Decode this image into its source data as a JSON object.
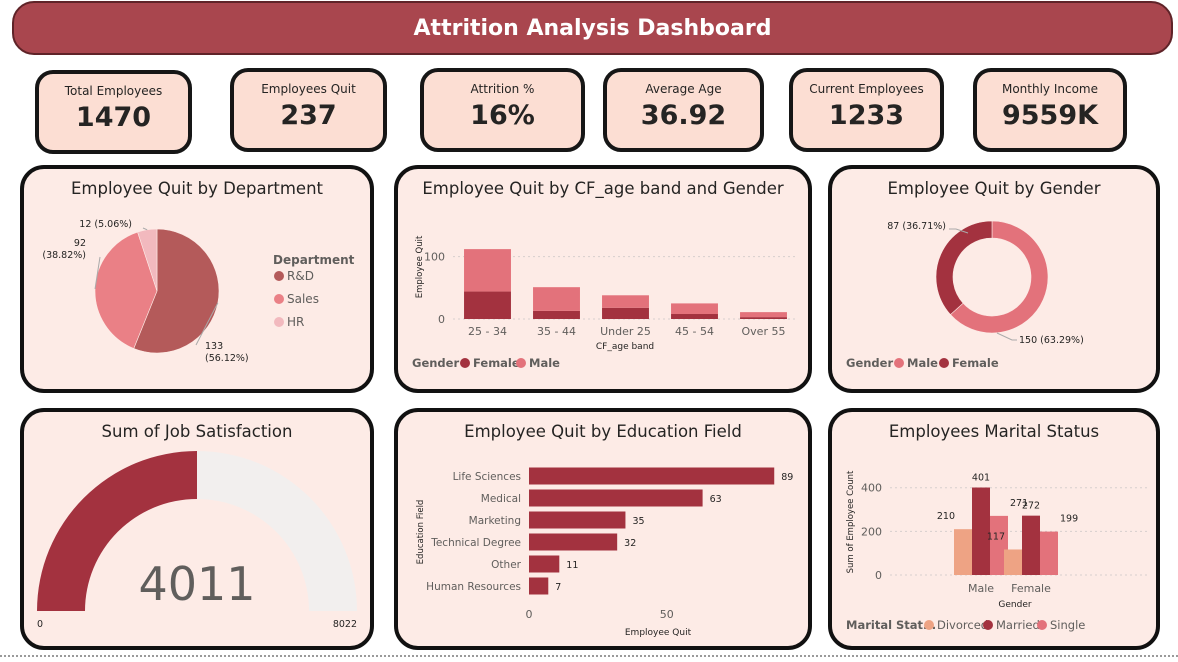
{
  "header": {
    "title": "Attrition Analysis Dashboard"
  },
  "kpis": [
    {
      "label": "Total Employees",
      "value": "1470"
    },
    {
      "label": "Employees Quit",
      "value": "237"
    },
    {
      "label": "Attrition %",
      "value": "16%"
    },
    {
      "label": "Average Age",
      "value": "36.92"
    },
    {
      "label": "Current Employees",
      "value": "1233"
    },
    {
      "label": "Monthly Income",
      "value": "9559K"
    }
  ],
  "colors": {
    "accent_dark": "#a3323f",
    "accent_mid": "#b45a5a",
    "male_pink": "#e3727b",
    "sales_pink": "#ea8086",
    "hr_pink": "#f2b9be",
    "divorced": "#eea384",
    "panel_bg": "#fdebe6",
    "kpi_bg": "#fcded3",
    "gauge_track": "#f2efee"
  },
  "chart_data": [
    {
      "type": "pie",
      "title": "Employee Quit by Department",
      "legend_title": "Department",
      "legend_position": "right",
      "slices": [
        {
          "label": "R&D",
          "value": 133,
          "text": "133 (56.12%)"
        },
        {
          "label": "Sales",
          "value": 92,
          "text": "92 (38.82%)"
        },
        {
          "label": "HR",
          "value": 12,
          "text": "12 (5.06%)"
        }
      ]
    },
    {
      "type": "bar",
      "stacked": true,
      "title": "Employee Quit by CF_age band and Gender",
      "xlabel": "CF_age band",
      "ylabel": "Employee Quit",
      "ylim": [
        0,
        125
      ],
      "yticks": [
        0,
        100
      ],
      "categories": [
        "25 - 34",
        "35 - 44",
        "Under 25",
        "45 - 54",
        "Over 55"
      ],
      "series": [
        {
          "name": "Female",
          "values": [
            44,
            13,
            18,
            8,
            3
          ]
        },
        {
          "name": "Male",
          "values": [
            68,
            38,
            20,
            17,
            8
          ]
        }
      ],
      "legend_title": "Gender",
      "legend_position": "bottom-left"
    },
    {
      "type": "pie",
      "donut": true,
      "title": "Employee Quit by Gender",
      "legend_title": "Gender",
      "legend_position": "bottom-left",
      "slices": [
        {
          "label": "Male",
          "value": 150,
          "text": "150 (63.29%)"
        },
        {
          "label": "Female",
          "value": 87,
          "text": "87 (36.71%)"
        }
      ]
    },
    {
      "type": "gauge",
      "title": "Sum of Job Satisfaction",
      "value": 4011,
      "value_text": "4011",
      "min": 0,
      "max": 8022,
      "min_text": "0",
      "max_text": "8022"
    },
    {
      "type": "bar",
      "orientation": "horizontal",
      "title": "Employee Quit by Education Field",
      "xlabel": "Employee Quit",
      "ylabel": "Education Field",
      "xlim": [
        0,
        90
      ],
      "xticks": [
        0,
        50
      ],
      "categories": [
        "Life Sciences",
        "Medical",
        "Marketing",
        "Technical Degree",
        "Other",
        "Human Resources"
      ],
      "values": [
        89,
        63,
        35,
        32,
        11,
        7
      ]
    },
    {
      "type": "bar",
      "title": "Employees Marital Status",
      "xlabel": "Gender",
      "ylabel": "Sum of Employee Count",
      "ylim": [
        0,
        440
      ],
      "yticks": [
        0,
        200,
        400
      ],
      "categories": [
        "Male",
        "Female"
      ],
      "series": [
        {
          "name": "Divorced",
          "values": [
            210,
            117
          ]
        },
        {
          "name": "Married",
          "values": [
            401,
            272
          ]
        },
        {
          "name": "Single",
          "values": [
            271,
            199
          ]
        }
      ],
      "legend_title": "Marital Stat...",
      "legend_position": "bottom-left"
    }
  ]
}
